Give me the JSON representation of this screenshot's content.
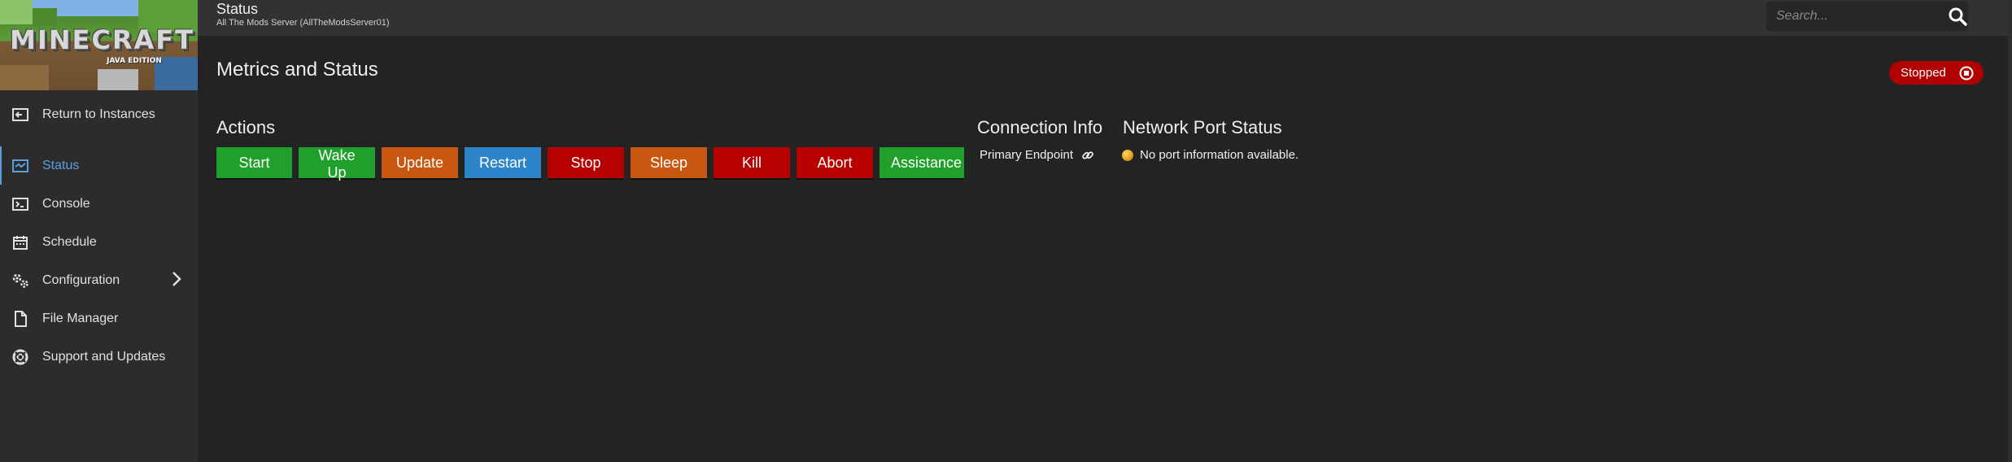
{
  "logo": {
    "title": "MINECRAFT",
    "subtitle": "JAVA EDITION"
  },
  "header": {
    "title": "Status",
    "subtitle": "All The Mods Server (AllTheModsServer01)"
  },
  "search": {
    "placeholder": "Search..."
  },
  "sidebar": {
    "items": [
      {
        "label": "Return to Instances",
        "icon": "return-icon"
      },
      {
        "label": "Status",
        "icon": "status-icon",
        "active": true
      },
      {
        "label": "Console",
        "icon": "console-icon"
      },
      {
        "label": "Schedule",
        "icon": "calendar-icon"
      },
      {
        "label": "Configuration",
        "icon": "gears-icon"
      },
      {
        "label": "File Manager",
        "icon": "file-icon"
      },
      {
        "label": "Support and Updates",
        "icon": "lifebuoy-icon"
      }
    ]
  },
  "main": {
    "heading": "Metrics and Status",
    "status_badge": "Stopped",
    "actions": {
      "title": "Actions",
      "buttons": [
        {
          "label": "Start",
          "color": "#1fa02a"
        },
        {
          "label": "Wake Up",
          "color": "#1fa02a"
        },
        {
          "label": "Update",
          "color": "#c8570f"
        },
        {
          "label": "Restart",
          "color": "#2e84c8"
        },
        {
          "label": "Stop",
          "color": "#b70000"
        },
        {
          "label": "Sleep",
          "color": "#c8570f"
        },
        {
          "label": "Kill",
          "color": "#b70000"
        },
        {
          "label": "Abort",
          "color": "#b70000"
        },
        {
          "label": "Assistance",
          "color": "#1fa02a"
        }
      ]
    },
    "connection_info": {
      "title": "Connection Info",
      "endpoint_label": "Primary Endpoint"
    },
    "network_port_status": {
      "title": "Network Port Status",
      "message": "No port information available."
    }
  },
  "colors": {
    "accent": "#5aa0e0",
    "background": "#232323",
    "sidebar": "#2c2c2c",
    "stopped": "#b00000"
  }
}
